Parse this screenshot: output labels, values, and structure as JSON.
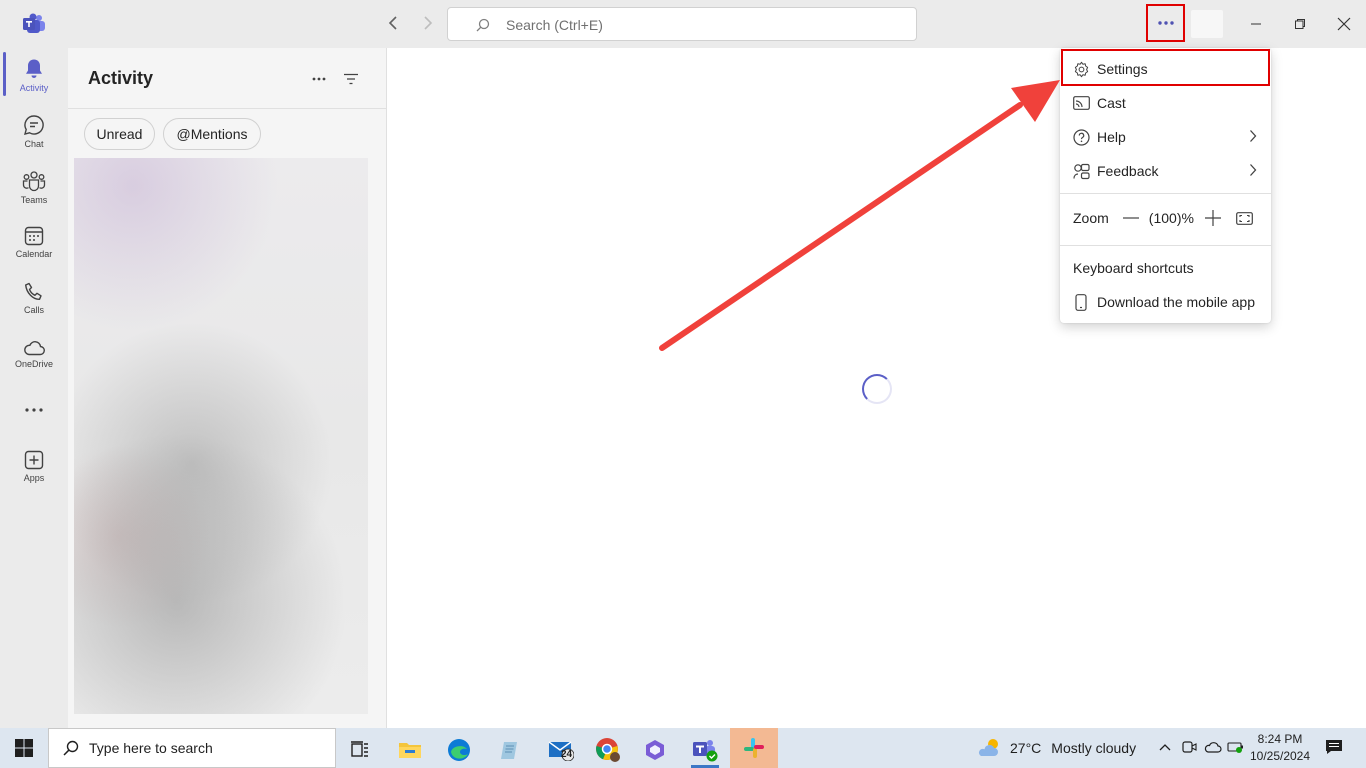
{
  "search": {
    "placeholder": "Search (Ctrl+E)"
  },
  "rail": {
    "items": [
      {
        "label": "Activity",
        "icon": "bell-icon",
        "active": true
      },
      {
        "label": "Chat",
        "icon": "chat-icon"
      },
      {
        "label": "Teams",
        "icon": "teams-icon"
      },
      {
        "label": "Calendar",
        "icon": "calendar-icon"
      },
      {
        "label": "Calls",
        "icon": "phone-icon"
      },
      {
        "label": "OneDrive",
        "icon": "cloud-icon"
      },
      {
        "label": "",
        "icon": "more-apps-icon"
      },
      {
        "label": "Apps",
        "icon": "add-app-icon"
      }
    ]
  },
  "activity": {
    "title": "Activity",
    "filters": [
      "Unread",
      "@Mentions"
    ]
  },
  "menu": {
    "settings": "Settings",
    "cast": "Cast",
    "help": "Help",
    "feedback": "Feedback",
    "zoom_label": "Zoom",
    "zoom_value": "(100)%",
    "keyboard_shortcuts": "Keyboard shortcuts",
    "download_mobile": "Download the mobile app"
  },
  "taskbar": {
    "search_text": "Type here to search",
    "mail_badge": "24",
    "temperature": "27°C",
    "weather": "Mostly cloudy",
    "time": "8:24 PM",
    "date": "10/25/2024"
  },
  "colors": {
    "accent": "#5b5fc7",
    "highlight": "#e00000",
    "arrow": "#f0413b"
  }
}
